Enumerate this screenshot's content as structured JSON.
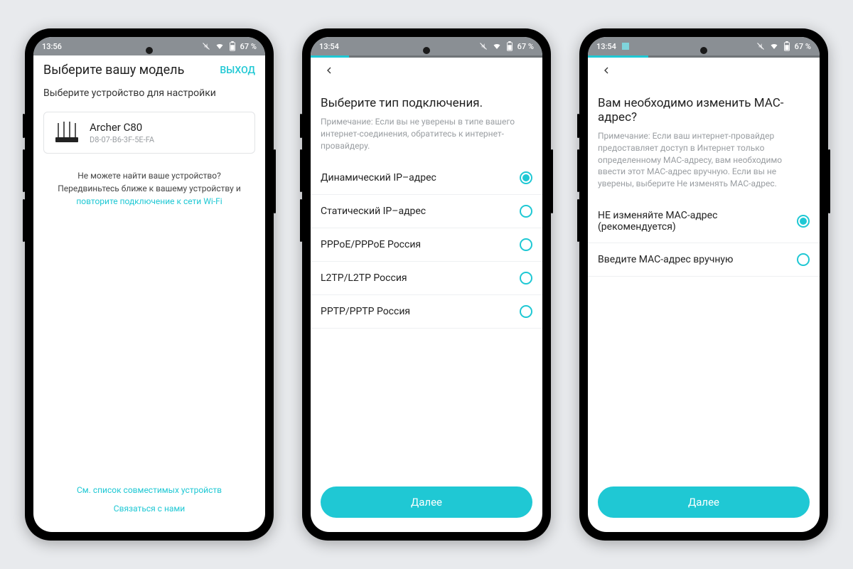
{
  "status": {
    "time1": "13:56",
    "time2": "13:54",
    "time3": "13:54",
    "battery": "67 %"
  },
  "phone1": {
    "title": "Выберите вашу модель",
    "exit": "ВЫХОД",
    "subtitle": "Выберите устройство для настройки",
    "device": {
      "name": "Archer C80",
      "mac": "D8-07-B6-3F-5E-FA"
    },
    "help_pre": "Не можете найти ваше устройство? Передвиньтесь ближе к вашему устройству и ",
    "help_link": "повторите подключение к сети Wi-Fi",
    "link1": "См. список совместимых устройств",
    "link2": "Связаться с нами"
  },
  "phone2": {
    "heading": "Выберите тип подключения.",
    "note": "Примечание: Если вы не уверены в типе вашего интернет-соединения, обратитесь к интернет-провайдеру.",
    "options": [
      "Динамический IP–адрес",
      "Статический IP–адрес",
      "PPPoE/PPPoE Россия",
      "L2TP/L2TP Россия",
      "PPTP/PPTP Россия"
    ],
    "selected": 0,
    "next": "Далее"
  },
  "phone3": {
    "heading": "Вам необходимо изменить MAC-адрес?",
    "note": "Примечание: Если ваш интернет-провайдер предоставляет доступ в Интернет только определенному MAC-адресу, вам необходимо ввести этот MAC-адрес вручную. Если вы не уверены, выберите Не изменять MAC-адрес.",
    "options": [
      "НЕ изменяйте МАС-адрес (рекомендуется)",
      "Введите МАС-адрес вручную"
    ],
    "selected": 0,
    "next": "Далее"
  }
}
